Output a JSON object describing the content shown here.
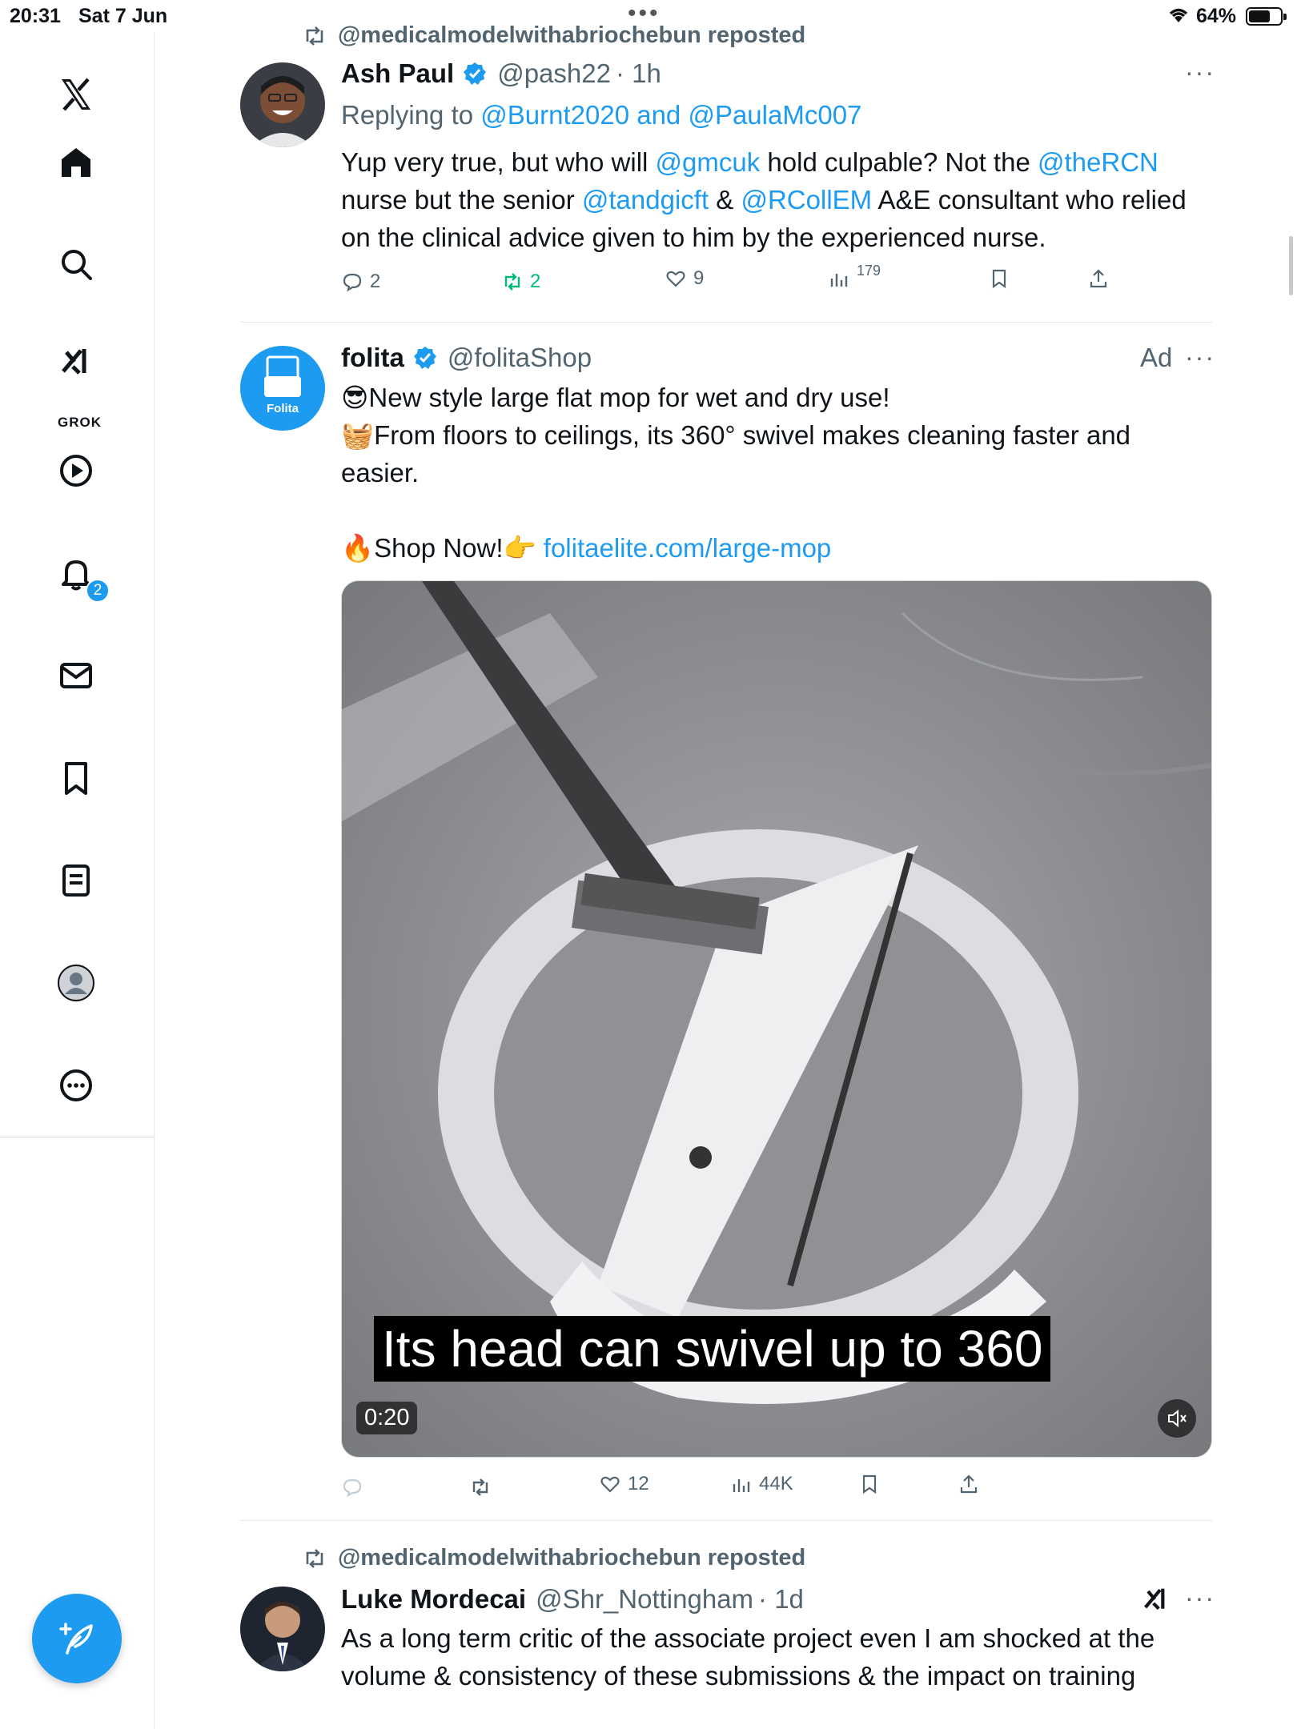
{
  "status_bar": {
    "time": "20:31",
    "date": "Sat 7 Jun",
    "battery": "64%"
  },
  "sidebar": {
    "items": [
      {
        "icon": "x-logo-icon"
      },
      {
        "icon": "home-icon"
      },
      {
        "icon": "search-icon"
      },
      {
        "icon": "grok-icon",
        "label": "GROK"
      },
      {
        "icon": "video-play-icon"
      },
      {
        "icon": "notifications-bell-icon",
        "badge": "2"
      },
      {
        "icon": "messages-envelope-icon"
      },
      {
        "icon": "bookmarks-icon"
      },
      {
        "icon": "lists-icon"
      },
      {
        "icon": "profile-icon"
      },
      {
        "icon": "more-circle-icon"
      }
    ],
    "compose": {
      "icon": "compose-feather-icon"
    }
  },
  "tweets": [
    {
      "repost_by": "@medicalmodelwithabriochebun reposted",
      "name": "Ash Paul",
      "handle": "@pash22",
      "time": "· 1h",
      "reply_prefix": "Replying to ",
      "reply_to": "@Burnt2020 and @PaulaMc007",
      "text": [
        {
          "t": "Yup very true, but who will "
        },
        {
          "t": "@gmcuk",
          "link": true
        },
        {
          "t": " hold culpable? Not the "
        },
        {
          "t": "@theRCN",
          "link": true
        },
        {
          "t": " nurse but the senior "
        },
        {
          "t": "@tandgicft",
          "link": true
        },
        {
          "t": " & "
        },
        {
          "t": "@RCollEM",
          "link": true
        },
        {
          "t": " A&E consultant who relied on the clinical advice given to him by the experienced nurse."
        }
      ],
      "stats": {
        "replies": "2",
        "reposts": "2",
        "likes": "9",
        "views": "179"
      }
    },
    {
      "name": "folita",
      "handle": "@folitaShop",
      "ad_label": "Ad",
      "avatar_text": "Folita",
      "line1": "😎New style large flat mop for wet and dry use!",
      "line2": "🧺From floors to ceilings, its 360° swivel makes cleaning faster and easier.",
      "line3_prefix": "🔥Shop Now!👉 ",
      "link": "folitaelite.com/large-mop",
      "video": {
        "caption": "Its head can swivel up to 360",
        "duration": "0:20"
      },
      "stats": {
        "replies": "",
        "reposts": "",
        "likes": "12",
        "views": "44K"
      }
    },
    {
      "repost_by": "@medicalmodelwithabriochebun reposted",
      "name": "Luke Mordecai",
      "handle": "@Shr_Nottingham",
      "time": "· 1d",
      "text_plain": "As a long term critic of the associate project even I am shocked at the volume & consistency of these submissions & the impact on training"
    }
  ],
  "colors": {
    "accent": "#1d9bf0",
    "repost_green": "#00ba7c",
    "muted": "#536471",
    "text": "#0f1419"
  }
}
